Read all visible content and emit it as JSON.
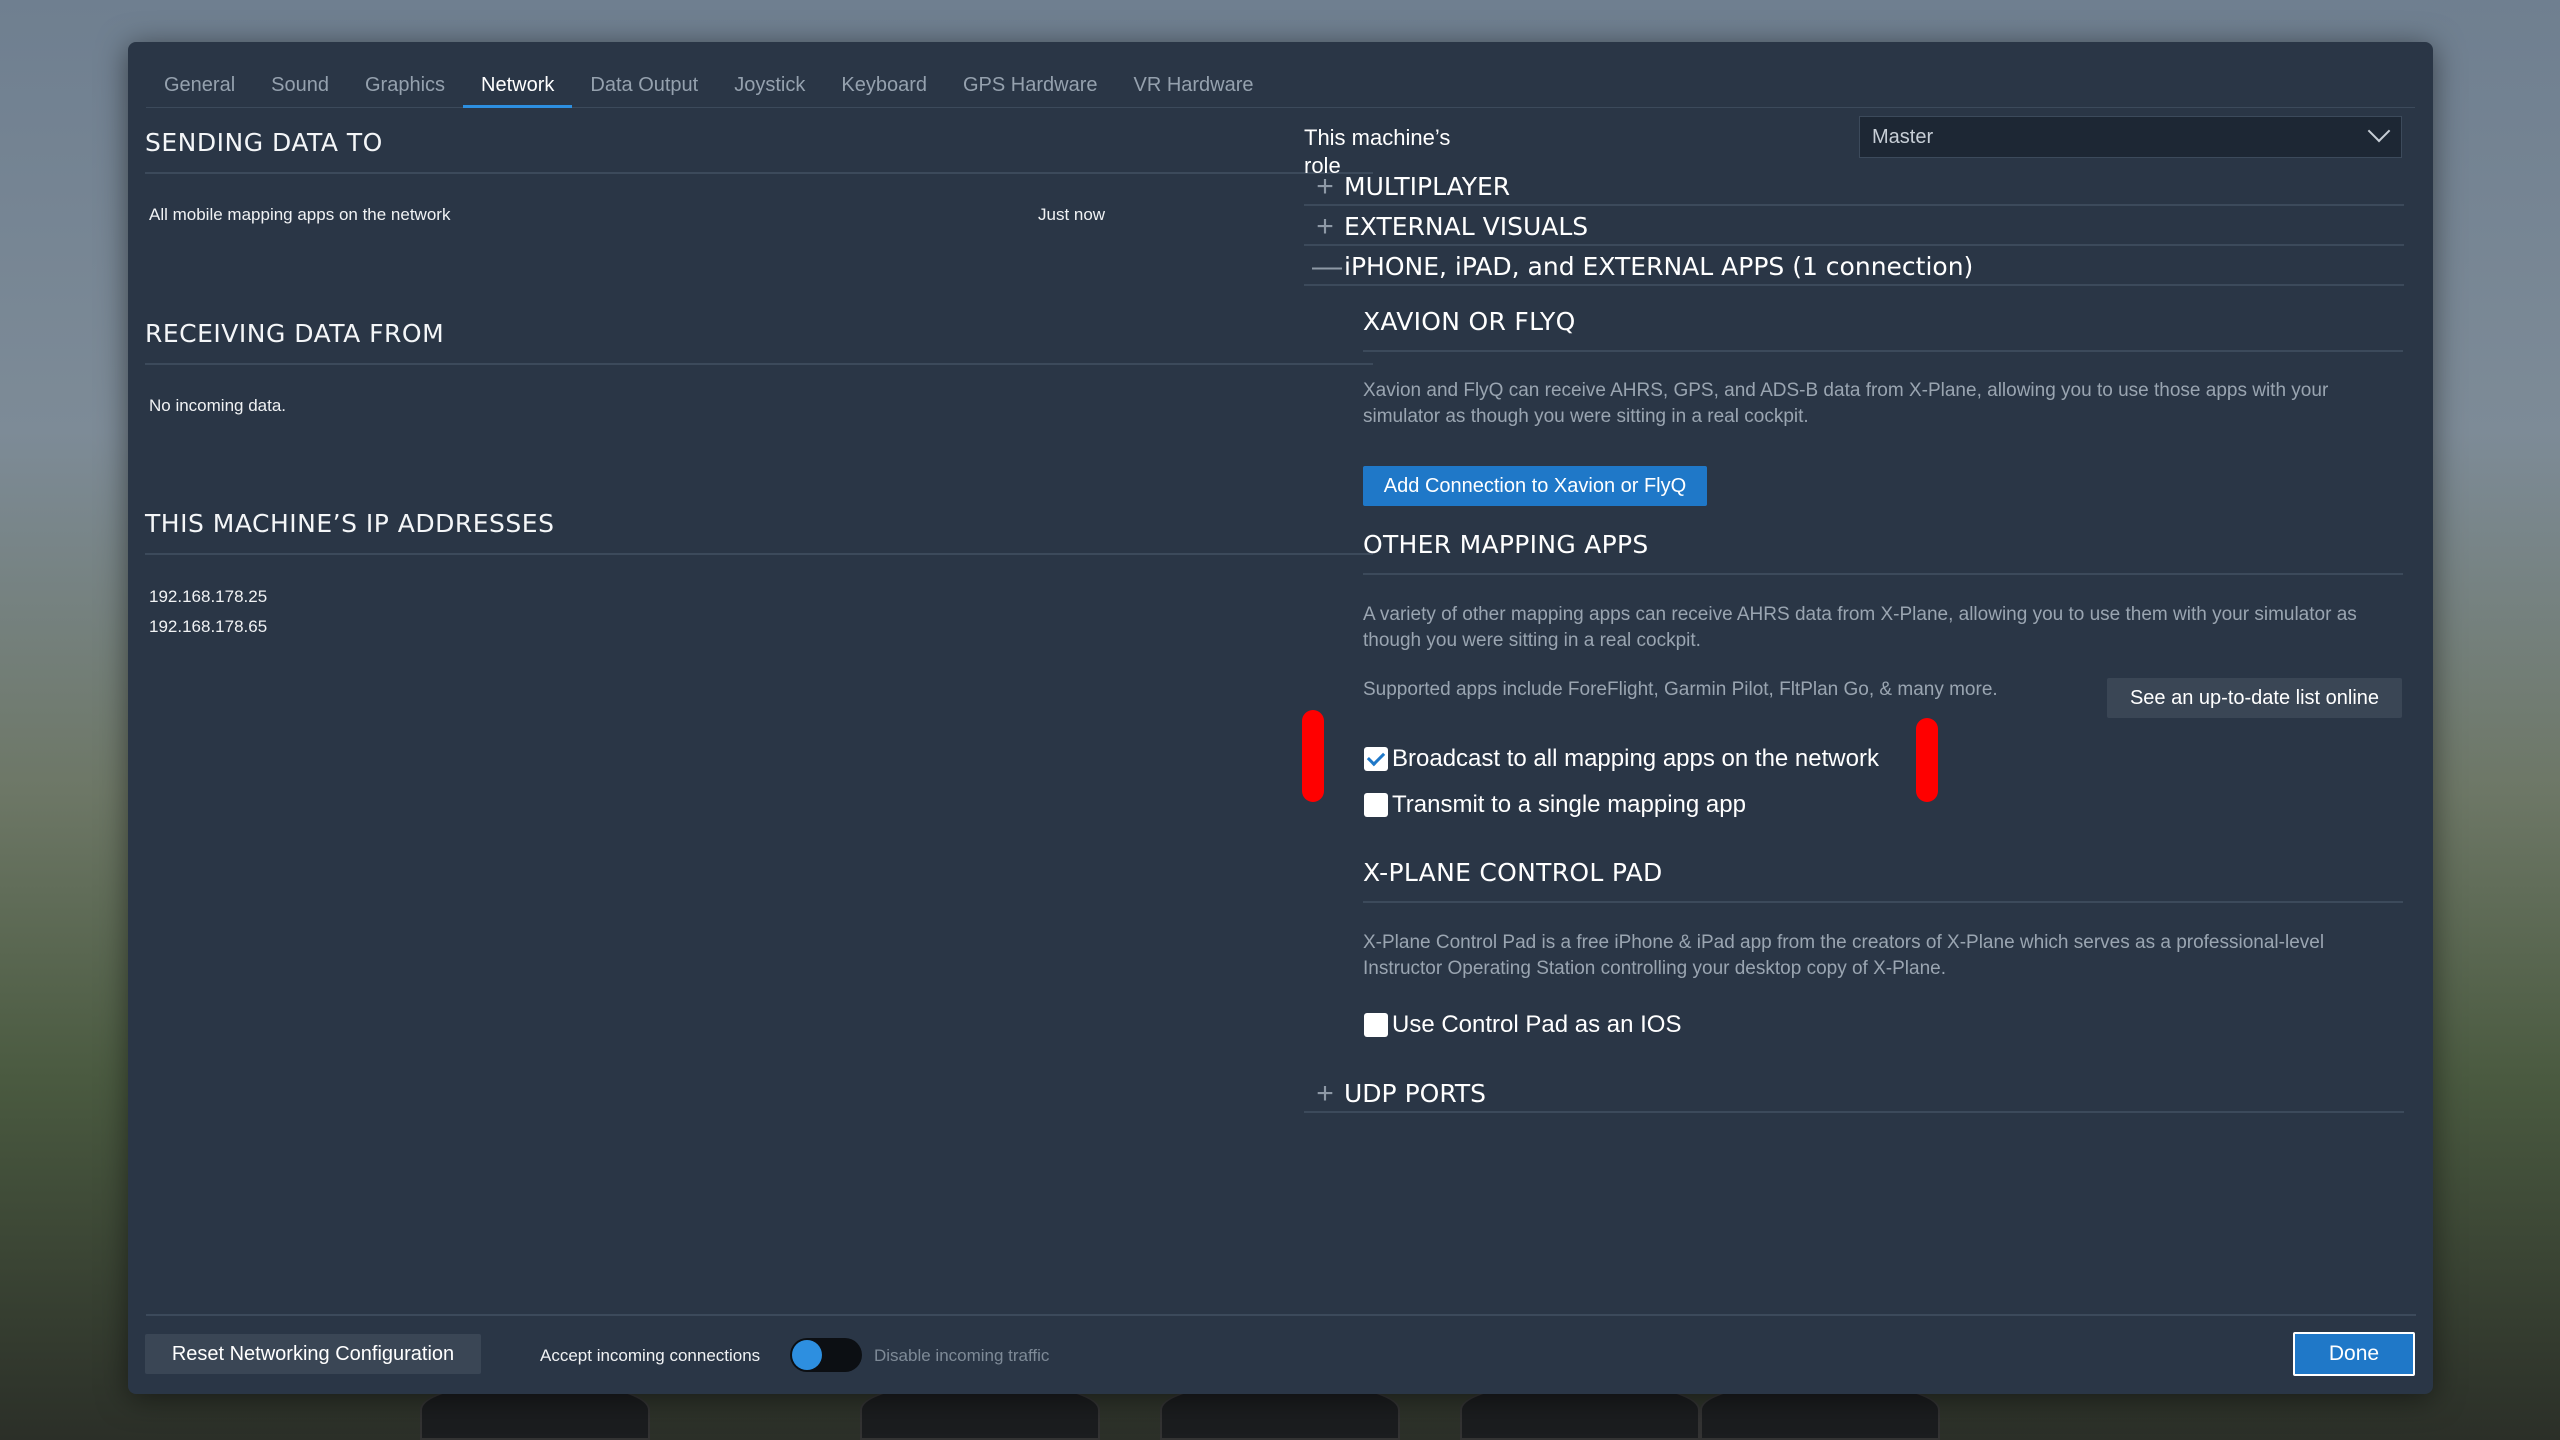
{
  "tabs": [
    "General",
    "Sound",
    "Graphics",
    "Network",
    "Data Output",
    "Joystick",
    "Keyboard",
    "GPS Hardware",
    "VR Hardware"
  ],
  "left": {
    "sending_title": "SENDING DATA TO",
    "sending_item": "All mobile mapping apps on the network",
    "sending_time": "Just now",
    "receiving_title": "RECEIVING DATA FROM",
    "receiving_item": "No incoming data.",
    "ip_title": "THIS MACHINE’S IP ADDRESSES",
    "ip_1": "192.168.178.25",
    "ip_2": "192.168.178.65"
  },
  "right": {
    "role_label": "This machine’s role",
    "role_value": "Master",
    "acc_multiplayer": "MULTIPLAYER",
    "acc_external_visuals": "EXTERNAL VISUALS",
    "acc_iphone": "iPHONE, iPAD, and EXTERNAL APPS (1 connection)",
    "acc_udp": "UDP PORTS",
    "xavion_title": "XAVION OR FLYQ",
    "xavion_desc": "Xavion and FlyQ can receive AHRS, GPS, and ADS-B data from X-Plane, allowing you to use those apps with your simulator as though you were sitting in a real cockpit.",
    "xavion_button": "Add Connection to Xavion or FlyQ",
    "other_title": "OTHER MAPPING APPS",
    "other_desc": "A variety of other mapping apps can receive AHRS data from X-Plane, allowing you to use them with your simulator as though you were sitting in a real cockpit.",
    "supported": "Supported apps include ForeFlight, Garmin Pilot, FltPlan Go, & many more.",
    "see_list_button": "See an up-to-date list online",
    "broadcast_label": "Broadcast to all mapping apps on the network",
    "broadcast_checked": true,
    "single_label": "Transmit to a single mapping app",
    "single_checked": false,
    "controlpad_title": "X-PLANE CONTROL PAD",
    "controlpad_desc": "X-Plane Control Pad is a free iPhone & iPad app from the creators of X-Plane which serves as a professional-level Instructor Operating Station controlling your desktop copy of X-Plane.",
    "controlpad_label": "Use Control Pad as an IOS",
    "controlpad_checked": false
  },
  "footer": {
    "reset_button": "Reset Networking Configuration",
    "accept_label": "Accept incoming connections",
    "accept_on": true,
    "disable_label": "Disable incoming traffic",
    "done_button": "Done"
  },
  "colors": {
    "accent": "#1f78c8",
    "panel": "#2a3646",
    "highlight_marker": "#ff0000"
  }
}
